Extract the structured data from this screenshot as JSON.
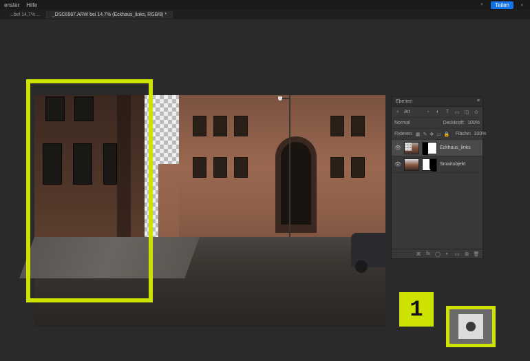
{
  "menu": {
    "item1": "enster",
    "item2": "Hilfe"
  },
  "toolbar": {
    "share": "Teilen"
  },
  "tabs": {
    "t1": "...bel 14,7% ...",
    "t2": "_DSC6987.ARW bei 14,7% (Eckhaus_links, RGB/8) *"
  },
  "panel": {
    "title": "Ebenen",
    "search_placeholder": "Art",
    "blend_mode": "Normal",
    "opacity_label": "Deckkraft:",
    "opacity_value": "100%",
    "lock_label": "Fixieren:",
    "fill_label": "Fläche:",
    "fill_value": "100%"
  },
  "layers": [
    {
      "name": "Eckhaus_links",
      "visible": true
    },
    {
      "name": "Smartobjekt",
      "visible": true
    }
  ],
  "callout": {
    "number": "1"
  }
}
